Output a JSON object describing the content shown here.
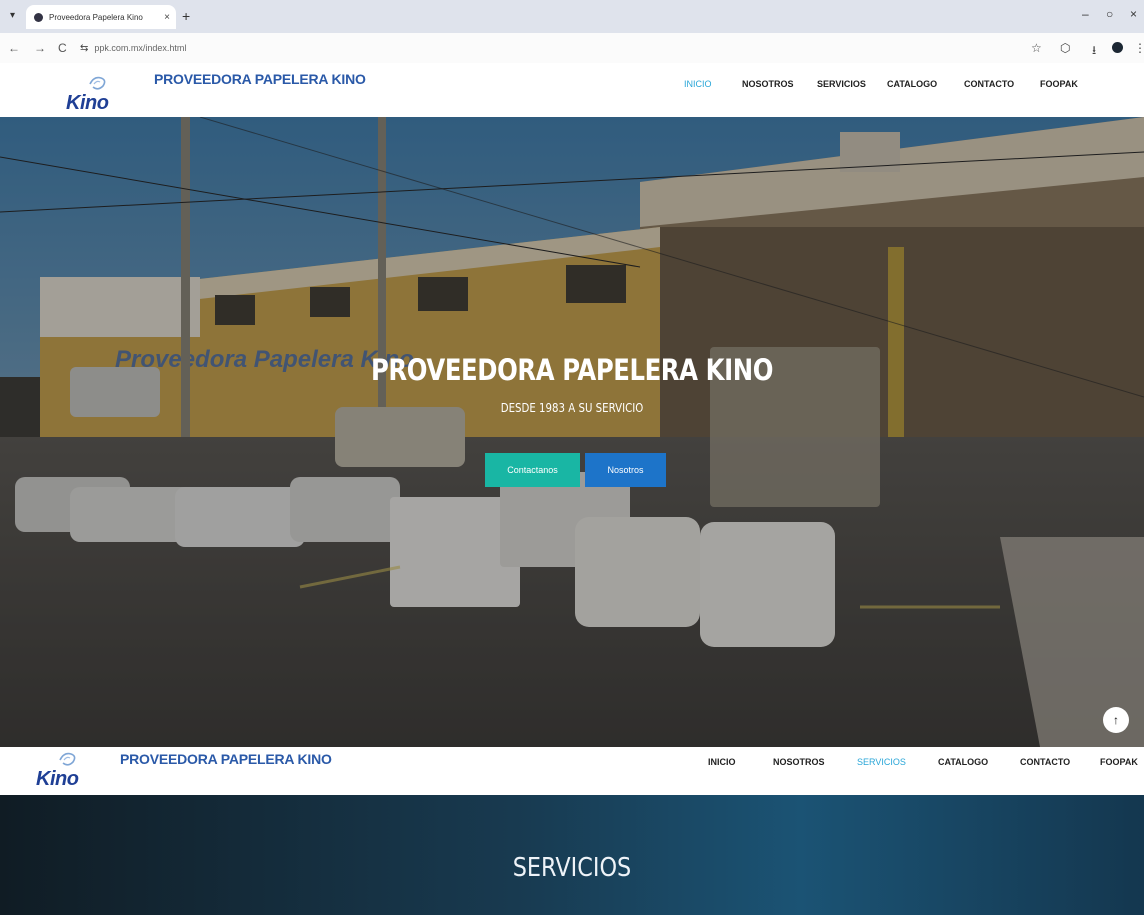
{
  "browser": {
    "tab_title": "Proveedora Papelera Kino",
    "url": "ppk.com.mx/index.html",
    "tab_close": "×",
    "new_tab": "+",
    "back": "←",
    "forward": "→",
    "reload": "C",
    "site_info": "⇆",
    "bookmark": "☆",
    "extensions": "⬡",
    "download": "⭳",
    "menu": "⋮",
    "minimize": "–",
    "maximize": "○",
    "close": "×"
  },
  "header": {
    "logo_text": "Kino",
    "brand": "PROVEEDORA PAPELERA KINO",
    "menu": [
      {
        "label": "INICIO"
      },
      {
        "label": "NOSOTROS"
      },
      {
        "label": "SERVICIOS"
      },
      {
        "label": "CATALOGO"
      },
      {
        "label": "CONTACTO"
      },
      {
        "label": "FOOPAK"
      }
    ]
  },
  "hero": {
    "title": "PROVEEDORA PAPELERA KINO",
    "subtitle": "DESDE 1983 A SU SERVICIO",
    "sign_text": "Proveedora Papelera Kino",
    "button_contact": "Contactanos",
    "button_about": "Nosotros",
    "to_top_icon": "↑"
  },
  "sticky_header": {
    "logo_text": "Kino",
    "brand": "PROVEEDORA PAPELERA KINO",
    "menu": [
      {
        "label": "INICIO"
      },
      {
        "label": "NOSOTROS"
      },
      {
        "label": "SERVICIOS"
      },
      {
        "label": "CATALOGO"
      },
      {
        "label": "CONTACTO"
      },
      {
        "label": "FOOPAK"
      }
    ]
  },
  "services": {
    "title": "SERVICIOS"
  },
  "colors": {
    "brand_blue": "#2a59a8",
    "active_link": "#29a6d8",
    "btn_teal": "#19b6a4",
    "btn_blue": "#1d74c9"
  }
}
